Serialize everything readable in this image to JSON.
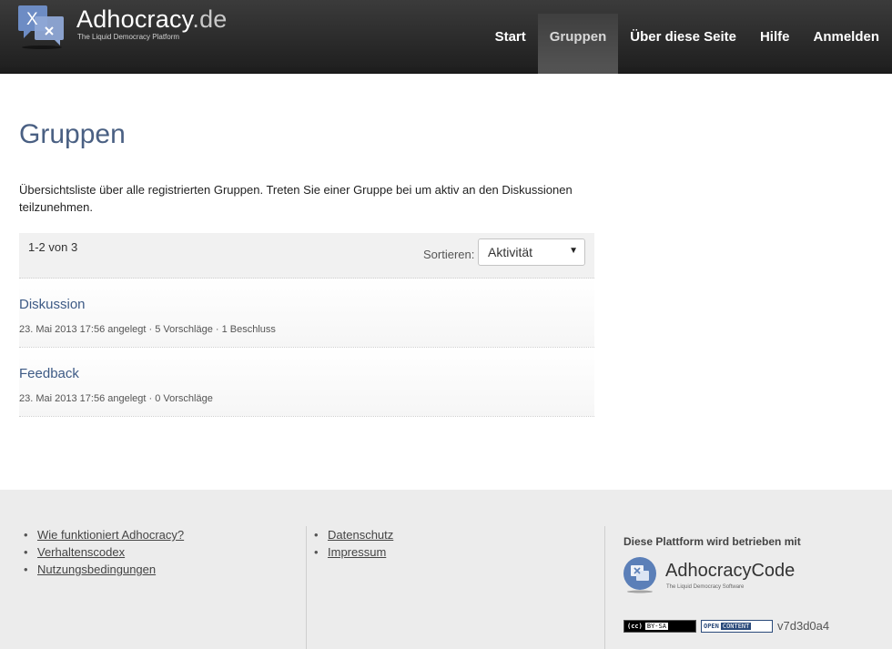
{
  "header": {
    "logo_name": "Adhocracy",
    "logo_tld": ".de",
    "logo_tagline": "The Liquid Democracy Platform",
    "logo_icon_letter": "X",
    "nav": [
      {
        "label": "Start",
        "active": false
      },
      {
        "label": "Gruppen",
        "active": true
      },
      {
        "label": "Über diese Seite",
        "active": false
      },
      {
        "label": "Hilfe",
        "active": false
      },
      {
        "label": "Anmelden",
        "active": false
      }
    ]
  },
  "main": {
    "title": "Gruppen",
    "intro": "Übersichtsliste über alle registrierten Gruppen. Treten Sie einer Gruppe bei um aktiv an den Diskussionen teilzunehmen.",
    "count": "1-2 von 3",
    "sort_label": "Sortieren:",
    "sort_value": "Aktivität",
    "groups": [
      {
        "title": "Diskussion",
        "meta": "23. Mai 2013 17:56 angelegt · 5 Vorschläge · 1 Beschluss"
      },
      {
        "title": "Feedback",
        "meta": "23. Mai 2013 17:56 angelegt · 0 Vorschläge"
      }
    ]
  },
  "footer": {
    "col1": [
      "Wie funktioniert Adhocracy?",
      "Verhaltenscodex",
      "Nutzungsbedingungen"
    ],
    "col2": [
      "Datenschutz",
      "Impressum"
    ],
    "powered_by": "Diese Plattform wird betrieben mit",
    "code_logo_name": "AdhocracyCode",
    "code_logo_tagline": "The Liquid Democracy Software",
    "cc_badge": {
      "prefix": "(cc)",
      "text": "BY-SA"
    },
    "oc_badge": {
      "prefix": "OPEN",
      "text": "CONTENT"
    },
    "version": "v7d3d0a4"
  },
  "colors": {
    "header_bg": "#2a2a2a",
    "title_blue": "#4a6083",
    "link_blue": "#3d5a85",
    "logo_blue": "#5b7fb8"
  }
}
